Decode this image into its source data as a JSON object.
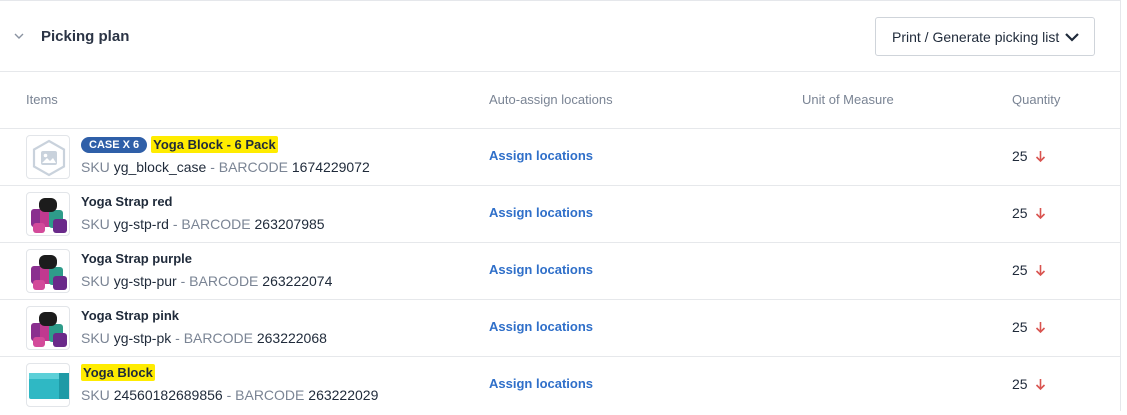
{
  "header": {
    "title": "Picking plan",
    "print_button_label": "Print / Generate picking list"
  },
  "columns": {
    "items": "Items",
    "auto_assign": "Auto-assign locations",
    "uom": "Unit of Measure",
    "quantity": "Quantity"
  },
  "labels": {
    "sku_prefix": "SKU",
    "barcode_prefix": "- BARCODE"
  },
  "rows": [
    {
      "badge": "CASE X 6",
      "name": "Yoga Block - 6 Pack",
      "sku": "yg_block_case",
      "barcode": "1674229072",
      "assign": "Assign locations",
      "quantity": "25",
      "uom": ""
    },
    {
      "badge": "",
      "name": "Yoga Strap red",
      "sku": "yg-stp-rd",
      "barcode": "263207985",
      "assign": "Assign locations",
      "quantity": "25",
      "uom": ""
    },
    {
      "badge": "",
      "name": "Yoga Strap purple",
      "sku": "yg-stp-pur",
      "barcode": "263222074",
      "assign": "Assign locations",
      "quantity": "25",
      "uom": ""
    },
    {
      "badge": "",
      "name": "Yoga Strap pink",
      "sku": "yg-stp-pk",
      "barcode": "263222068",
      "assign": "Assign locations",
      "quantity": "25",
      "uom": ""
    },
    {
      "badge": "",
      "name": "Yoga Block",
      "sku": "24560182689856",
      "barcode": "263222029",
      "assign": "Assign locations",
      "quantity": "25",
      "uom": ""
    }
  ],
  "colors": {
    "accent_link": "#2f6fc9",
    "badge": "#2f5fa8",
    "highlight": "#ffec00",
    "down_arrow": "#d9534f"
  }
}
